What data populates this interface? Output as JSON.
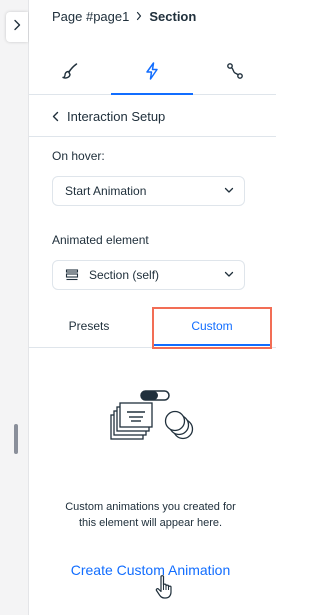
{
  "breadcrumb": {
    "page": "Page #page1",
    "current": "Section"
  },
  "top_tabs": [
    {
      "icon": "brush-icon",
      "active": false
    },
    {
      "icon": "lightning-icon",
      "active": true
    },
    {
      "icon": "path-curve-icon",
      "active": false
    }
  ],
  "header": {
    "back_label": "Interaction Setup"
  },
  "trigger": {
    "label": "On hover:",
    "value": "Start Animation"
  },
  "animated_element": {
    "label": "Animated element",
    "value": "Section (self)",
    "icon": "section-layout-icon"
  },
  "sub_tabs": {
    "presets": "Presets",
    "custom": "Custom",
    "active": "custom"
  },
  "empty_state": {
    "illustration": "animation-layers-illustration",
    "description_line1": "Custom animations you created for",
    "description_line2": "this element will appear here.",
    "action_label": "Create Custom Animation"
  },
  "colors": {
    "accent": "#116dff",
    "text": "#20303c",
    "divider": "#dfe5eb",
    "highlight": "#f26d55"
  }
}
